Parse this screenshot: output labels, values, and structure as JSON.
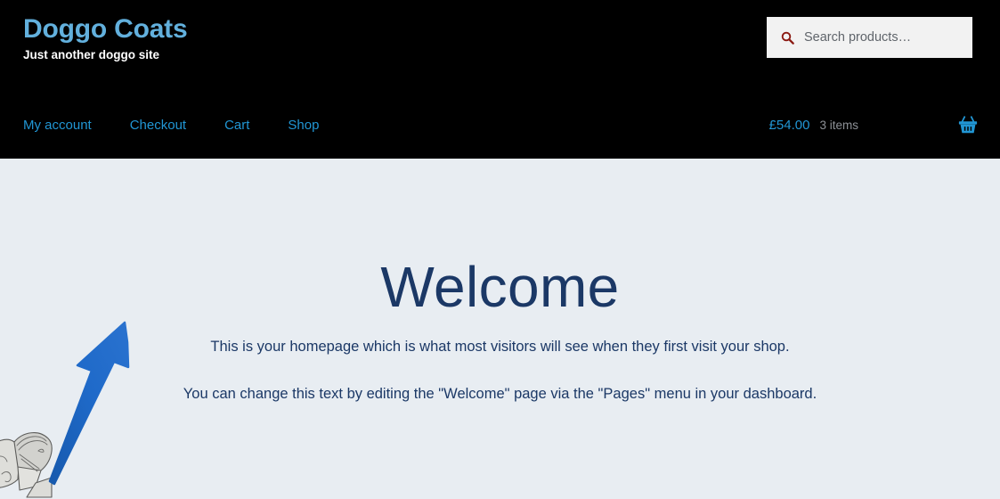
{
  "header": {
    "site_title": "Doggo Coats",
    "tagline": "Just another doggo site",
    "title_color": "#62b0dd",
    "background_color": "#000000"
  },
  "search": {
    "placeholder": "Search products…",
    "value": "",
    "icon": "search-icon",
    "icon_color": "#8b1a12",
    "field_background": "#f2f2f2"
  },
  "nav": {
    "items": [
      {
        "label": "My account"
      },
      {
        "label": "Checkout"
      },
      {
        "label": "Cart"
      },
      {
        "label": "Shop"
      }
    ],
    "link_color": "#2196d4"
  },
  "cart": {
    "total": "£54.00",
    "count": "3 items",
    "icon": "shopping-basket-icon",
    "icon_color": "#2196d4",
    "count_color": "#8d9196"
  },
  "main": {
    "page_title": "Welcome",
    "paragraph_1": "This is your homepage which is what most visitors will see when they first visit your shop.",
    "paragraph_2": "You can change this text by editing the \"Welcome\" page via the \"Pages\" menu in your dashboard.",
    "text_color": "#1b3866",
    "background_color": "#e8edf2"
  },
  "annotation": {
    "arrow": "arrow-pointing-up-right",
    "color": "#1a66c2",
    "target": "My account"
  },
  "decoration": {
    "image": "dog-coat-hood-sketch"
  }
}
